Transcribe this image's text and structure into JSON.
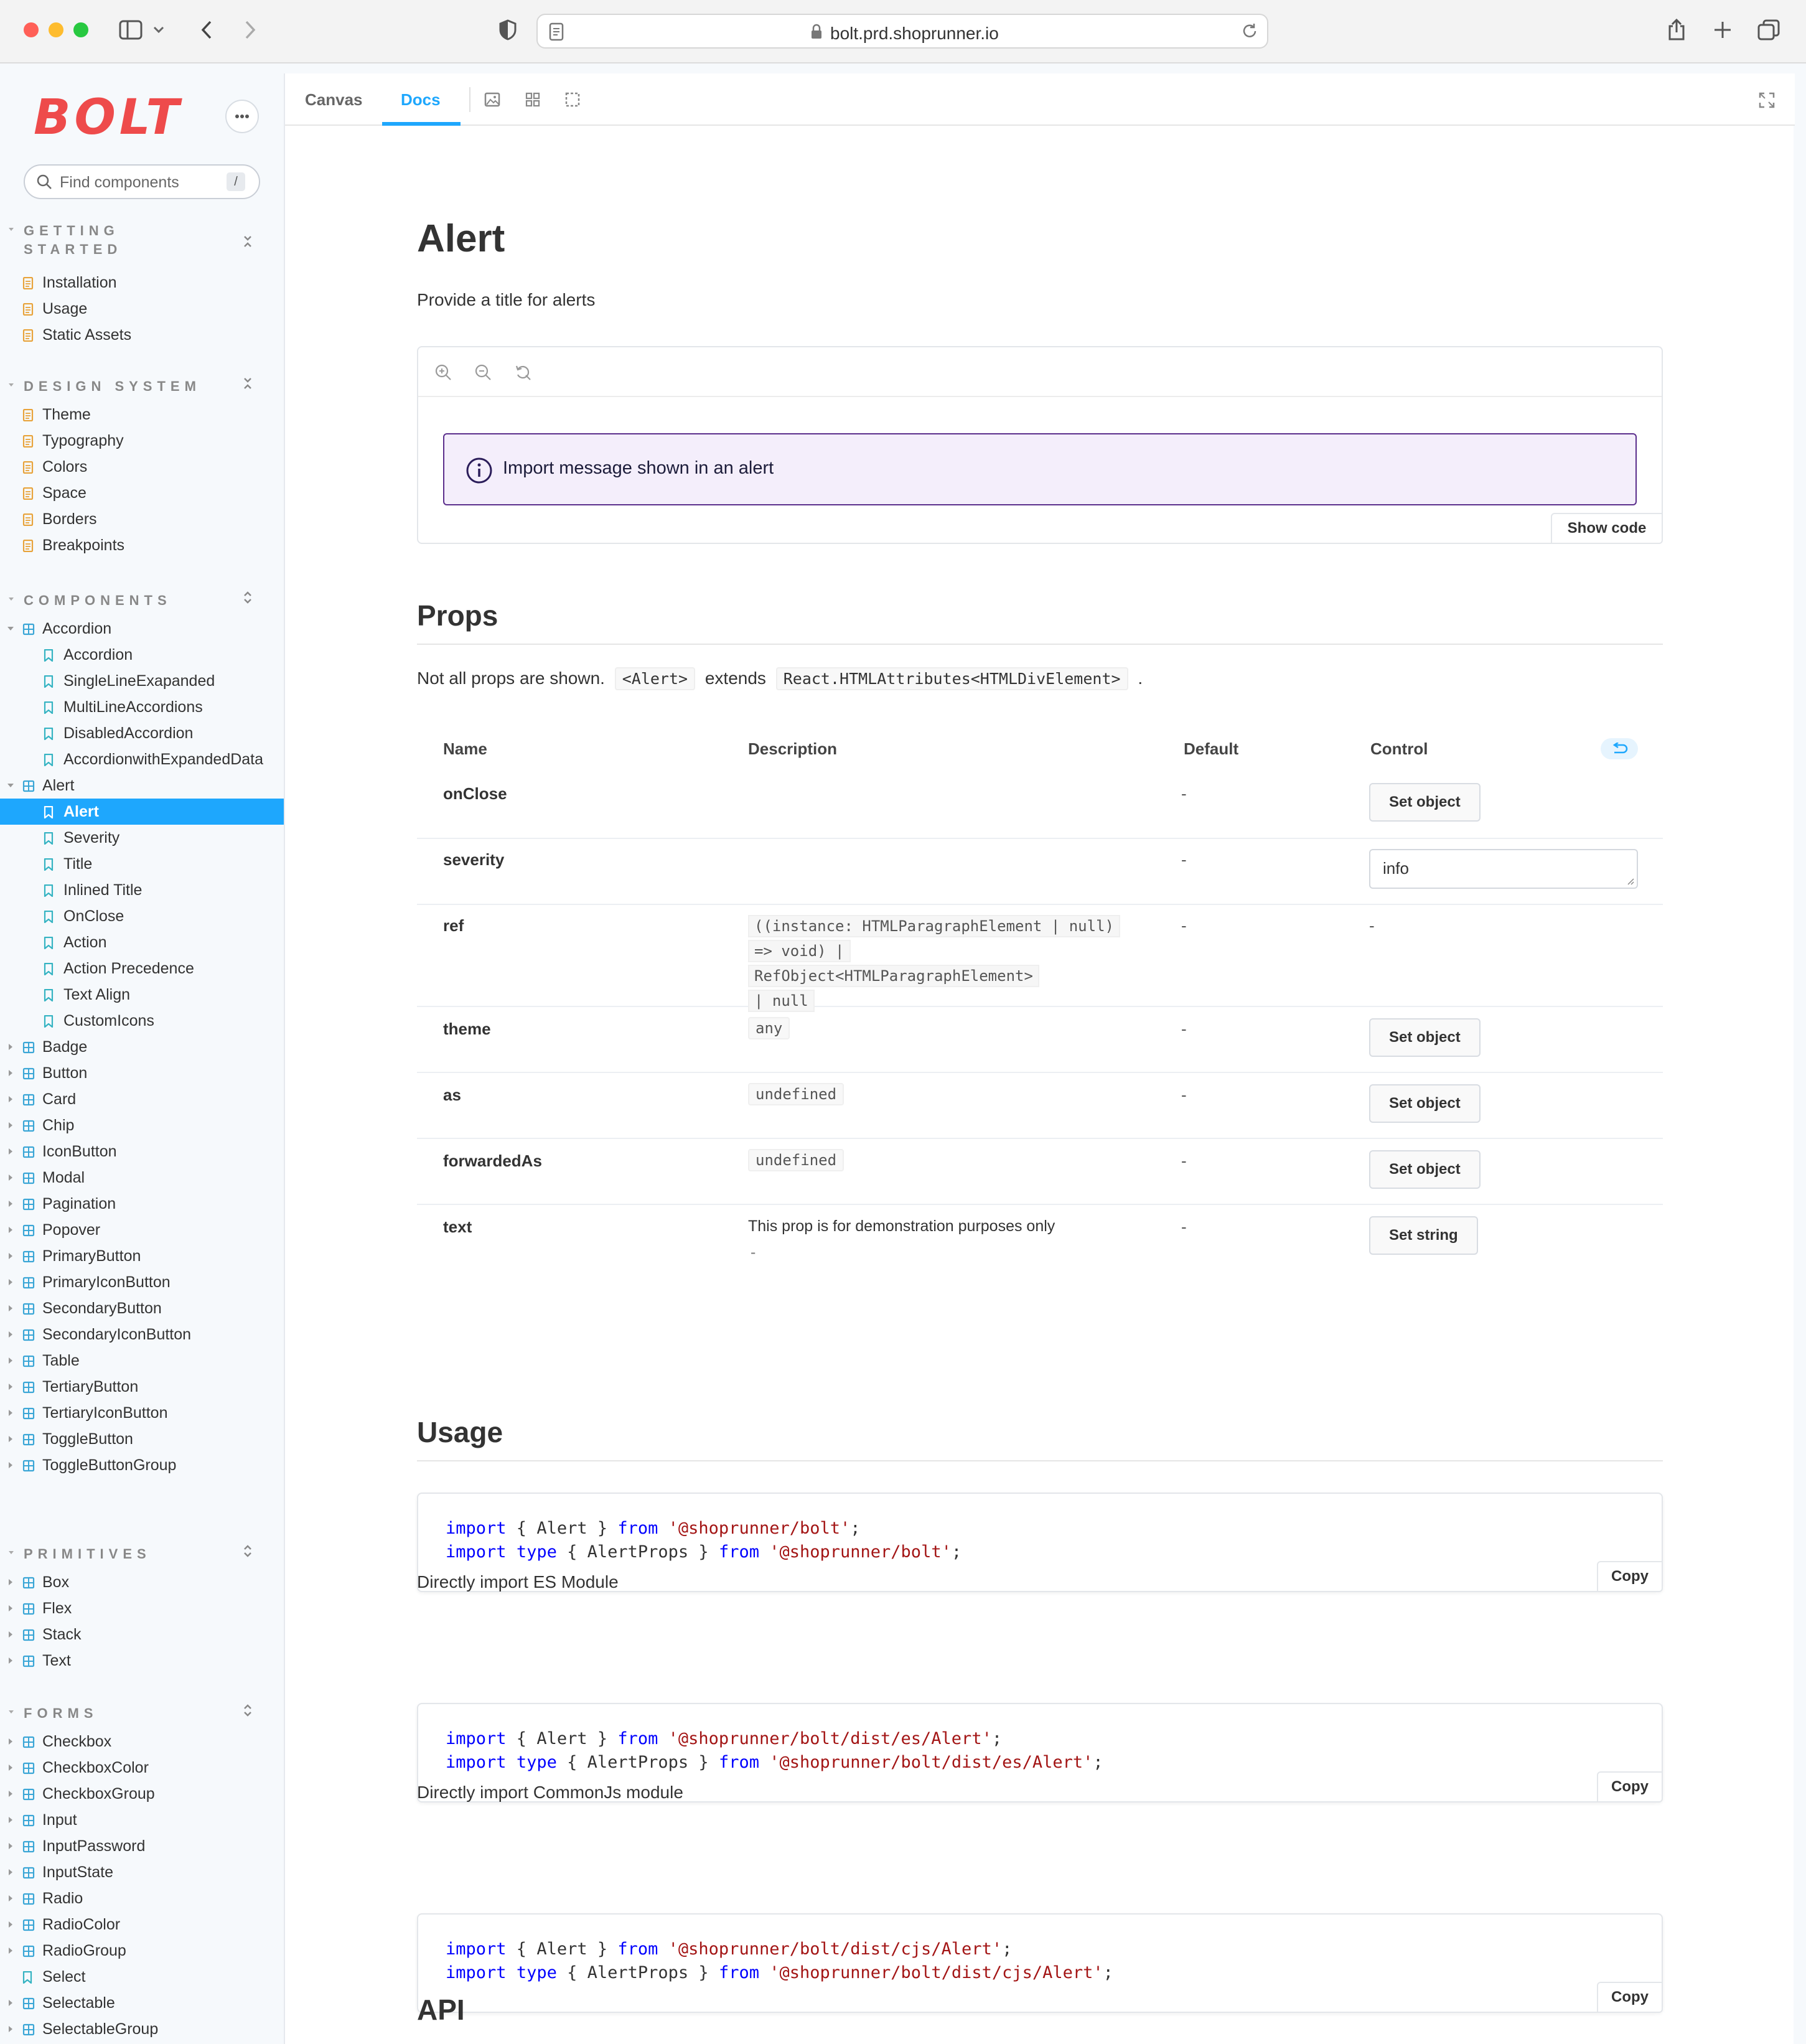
{
  "browser": {
    "url": "bolt.prd.shoprunner.io",
    "traffic_colors": [
      "#ff5f57",
      "#febc2e",
      "#28c840"
    ]
  },
  "sidebar": {
    "logo_text": "BOLT",
    "search_placeholder": "Find components",
    "search_shortcut": "/",
    "sections": {
      "getting_started": {
        "title_line1": "GETTING",
        "title_line2": "STARTED",
        "items": [
          "Installation",
          "Usage",
          "Static Assets"
        ]
      },
      "design_system": {
        "title": "DESIGN SYSTEM",
        "items": [
          "Theme",
          "Typography",
          "Colors",
          "Space",
          "Borders",
          "Breakpoints"
        ]
      },
      "components": {
        "title": "COMPONENTS",
        "accordion": {
          "label": "Accordion",
          "children": [
            "Accordion",
            "SingleLineExapanded",
            "MultiLineAccordions",
            "DisabledAccordion",
            "AccordionwithExpandedData"
          ]
        },
        "alert": {
          "label": "Alert",
          "children": [
            "Alert",
            "Severity",
            "Title",
            "Inlined Title",
            "OnClose",
            "Action",
            "Action Precedence",
            "Text Align",
            "CustomIcons"
          ]
        },
        "others": [
          "Badge",
          "Button",
          "Card",
          "Chip",
          "IconButton",
          "Modal",
          "Pagination",
          "Popover",
          "PrimaryButton",
          "PrimaryIconButton",
          "SecondaryButton",
          "SecondaryIconButton",
          "Table",
          "TertiaryButton",
          "TertiaryIconButton",
          "ToggleButton",
          "ToggleButtonGroup"
        ]
      },
      "primitives": {
        "title": "PRIMITIVES",
        "items": [
          "Box",
          "Flex",
          "Stack",
          "Text"
        ]
      },
      "forms": {
        "title": "FORMS",
        "items": [
          "Checkbox",
          "CheckboxColor",
          "CheckboxGroup",
          "Input",
          "InputPassword",
          "InputState",
          "Radio",
          "RadioColor",
          "RadioGroup",
          "Select",
          "Selectable",
          "SelectableGroup"
        ]
      }
    }
  },
  "toolbar": {
    "tab_canvas": "Canvas",
    "tab_docs": "Docs"
  },
  "doc": {
    "title": "Alert",
    "subtitle": "Provide a title for alerts",
    "preview": {
      "alert_message": "Import message shown in an alert",
      "show_code": "Show code"
    },
    "props": {
      "heading": "Props",
      "note_prefix": "Not all props are shown.",
      "note_component": "<Alert>",
      "note_extends": "extends",
      "note_type": "React.HTMLAttributes<HTMLDivElement>",
      "note_suffix": ".",
      "columns": {
        "name": "Name",
        "description": "Description",
        "default": "Default",
        "control": "Control"
      },
      "rows": {
        "onclose": {
          "name": "onClose",
          "default": "-",
          "control": "Set object"
        },
        "severity": {
          "name": "severity",
          "default": "-",
          "control_value": "info"
        },
        "ref": {
          "name": "ref",
          "type_line1": "((instance: HTMLParagraphElement | null)",
          "type_line2": "=> void) | RefObject<HTMLParagraphElement>",
          "type_line3": "| null",
          "default": "-",
          "control": "-"
        },
        "theme": {
          "name": "theme",
          "type": "any",
          "default": "-",
          "control": "Set object"
        },
        "as": {
          "name": "as",
          "type": "undefined",
          "default": "-",
          "control": "Set object"
        },
        "forwardedas": {
          "name": "forwardedAs",
          "type": "undefined",
          "default": "-",
          "control": "Set object"
        },
        "text": {
          "name": "text",
          "description": "This prop is for demonstration purposes only",
          "type": "-",
          "default": "-",
          "control": "Set string"
        }
      }
    },
    "usage": {
      "heading": "Usage",
      "kw_import": "import",
      "kw_type": "type",
      "kw_from": "from",
      "named_alert": " { Alert } ",
      "named_props": " { AlertProps } ",
      "block1_path": "'@shoprunner/bolt'",
      "label_es": "Directly import ES Module",
      "block2_path": "'@shoprunner/bolt/dist/es/Alert'",
      "label_cjs": "Directly import CommonJs module",
      "block3_path": "'@shoprunner/bolt/dist/cjs/Alert'",
      "terminator": ";",
      "copy": "Copy"
    },
    "api_heading": "API"
  },
  "colors": {
    "accent": "#1ea7fd",
    "logo": "#ee4b4b",
    "alert_border": "#5b2e8c",
    "alert_bg": "#f4eefb",
    "doc_icon": "#e8a33a",
    "component_icon": "#3aa6d6",
    "story_icon": "#34b3c2"
  }
}
